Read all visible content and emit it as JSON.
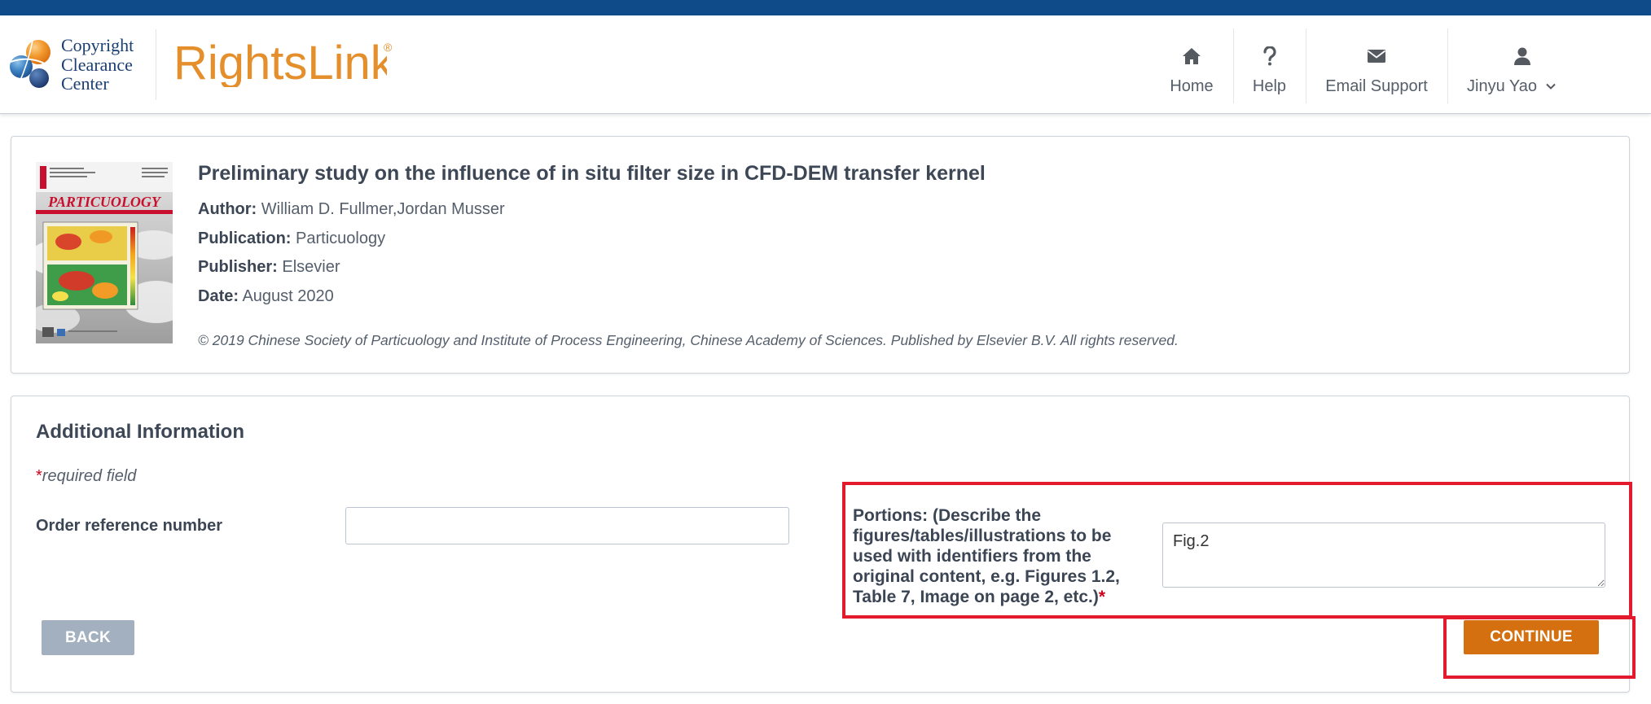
{
  "header": {
    "logo": {
      "icon": "ccc-globe-icon",
      "lines": [
        "Copyright",
        "Clearance",
        "Center"
      ]
    },
    "product": {
      "name": "RightsLink",
      "mark": "®"
    },
    "nav": {
      "home": {
        "label": "Home",
        "icon": "home-icon"
      },
      "help": {
        "label": "Help",
        "icon": "question-icon"
      },
      "email": {
        "label": "Email Support",
        "icon": "envelope-icon"
      },
      "user": {
        "label": "Jinyu Yao",
        "icon": "user-icon",
        "caret_icon": "chevron-down-icon"
      }
    }
  },
  "article": {
    "cover": {
      "journal_title": "PARTICUOLOGY"
    },
    "title": "Preliminary study on the influence of in situ filter size in CFD-DEM transfer kernel",
    "fields": [
      {
        "label": "Author:",
        "value": "William D. Fullmer,Jordan Musser"
      },
      {
        "label": "Publication:",
        "value": "Particuology"
      },
      {
        "label": "Publisher:",
        "value": "Elsevier"
      },
      {
        "label": "Date:",
        "value": "August 2020"
      }
    ],
    "copyright": "© 2019 Chinese Society of Particuology and Institute of Process Engineering, Chinese Academy of Sciences. Published by Elsevier B.V. All rights reserved."
  },
  "additional_info": {
    "heading": "Additional Information",
    "required": {
      "mark": "*",
      "text": "required field"
    },
    "order_reference": {
      "label": "Order reference number",
      "value": ""
    },
    "portions": {
      "label_lines": [
        "Portions: (Describe the",
        "figures/tables/illustrations to be",
        "used with identifiers from the",
        "original content, e.g. Figures 1.2,",
        "Table 7, Image on page 2, etc.)"
      ],
      "required_mark": "*",
      "value": "Fig.2"
    }
  },
  "actions": {
    "back_label": "BACK",
    "continue_label": "CONTINUE"
  },
  "colors": {
    "brand_blue": "#0f4a89",
    "brand_orange": "#e48e2c",
    "continue_button": "#d4700f",
    "back_button": "#a3b0bf",
    "required_red": "#d0021b",
    "annotation_red": "#e3192d"
  }
}
